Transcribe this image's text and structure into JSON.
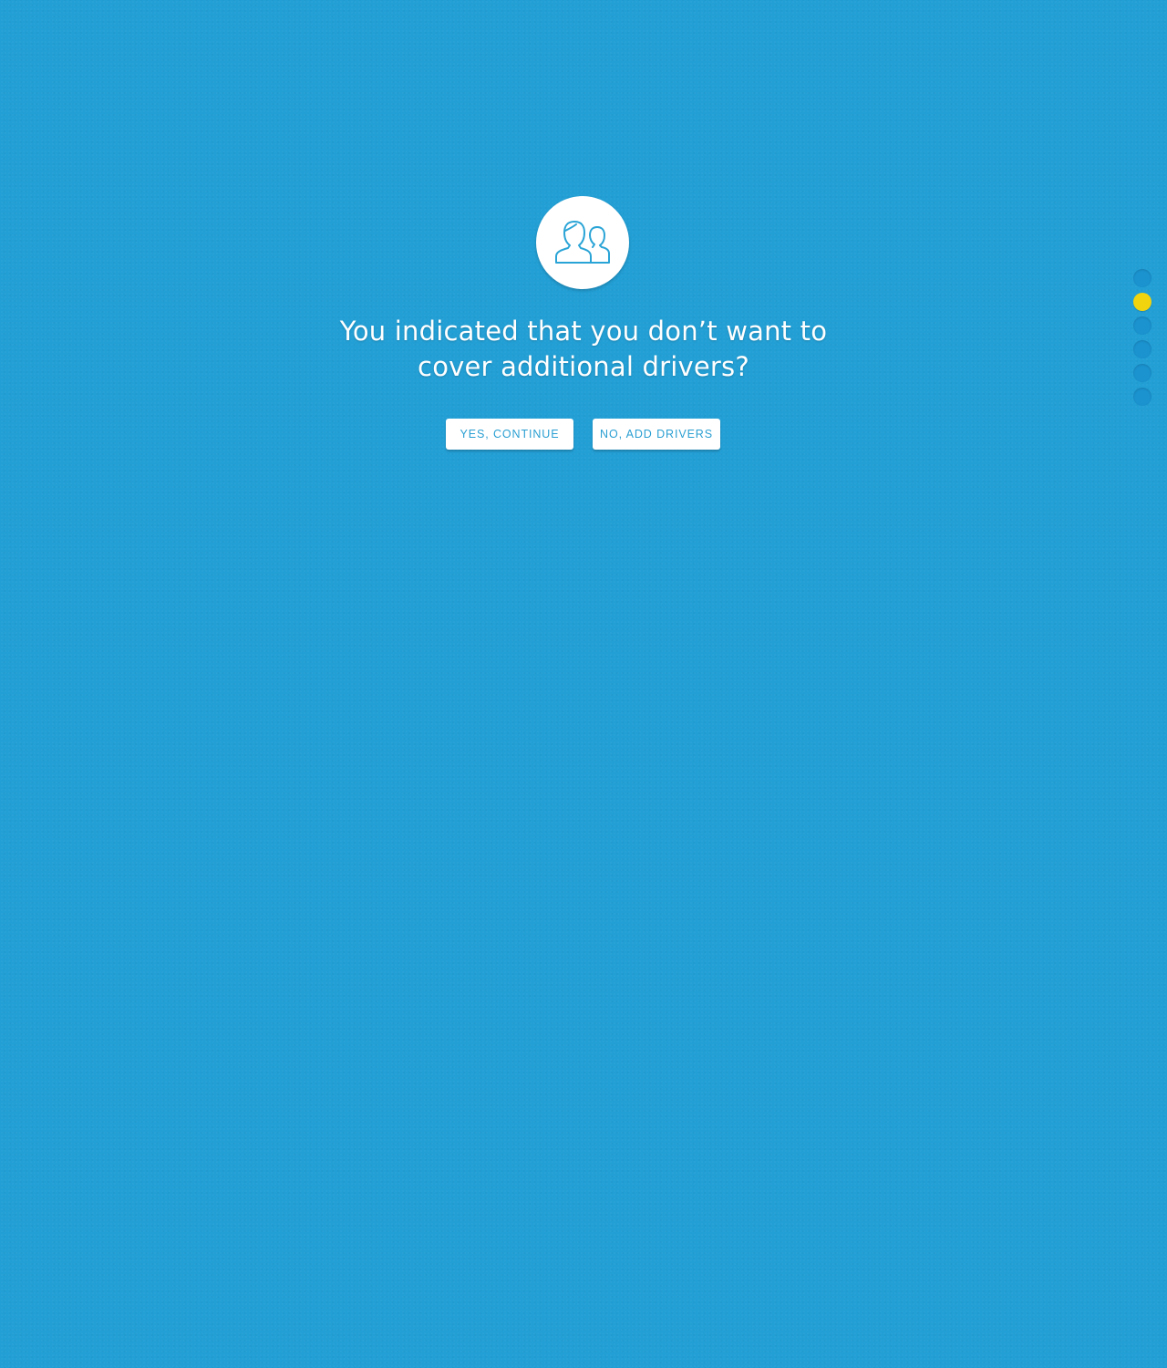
{
  "icon": {
    "name": "users-icon"
  },
  "question": {
    "line1": "You indicated that you don’t want to",
    "line2": "cover additional drivers?"
  },
  "buttons": {
    "yes_label": "YES, CONTINUE",
    "no_label": "NO, ADD DRIVERS"
  },
  "progress": {
    "total_steps": 6,
    "current_step": 2
  },
  "colors": {
    "background": "#229fd5",
    "button_text": "#2a9fd2",
    "active_dot": "#f2d40e",
    "inactive_dot": "#1b93cf"
  }
}
